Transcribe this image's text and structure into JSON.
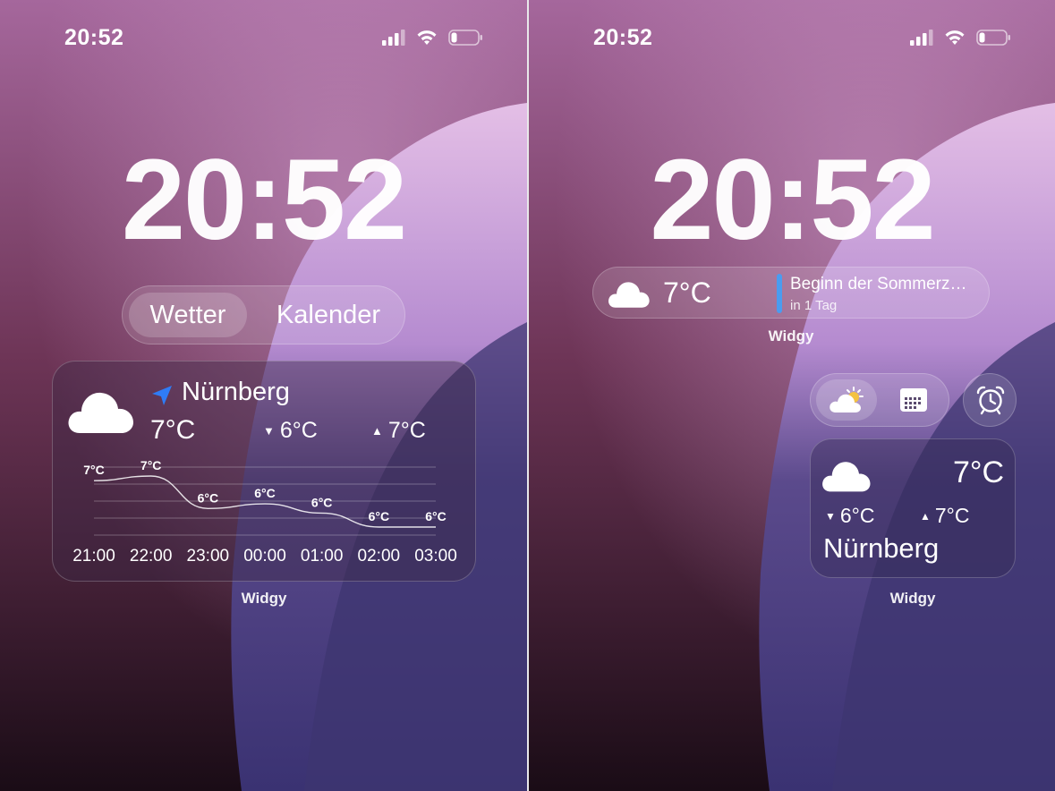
{
  "status_bar": {
    "time": "20:52"
  },
  "lock_clock": "20:52",
  "left": {
    "segment": {
      "items": [
        "Wetter",
        "Kalender"
      ],
      "selected": "Wetter"
    },
    "weather_widget": {
      "location": "Nürnberg",
      "current_temp": "7°C",
      "low": "6°C",
      "high": "7°C",
      "hourly": [
        {
          "time": "21:00",
          "temp_label": "7°C",
          "temp": 7.0
        },
        {
          "time": "22:00",
          "temp_label": "7°C",
          "temp": 7.1
        },
        {
          "time": "23:00",
          "temp_label": "6°C",
          "temp": 6.4
        },
        {
          "time": "00:00",
          "temp_label": "6°C",
          "temp": 6.5
        },
        {
          "time": "01:00",
          "temp_label": "6°C",
          "temp": 6.3
        },
        {
          "time": "02:00",
          "temp_label": "6°C",
          "temp": 6.0
        },
        {
          "time": "03:00",
          "temp_label": "6°C",
          "temp": 6.0
        }
      ]
    },
    "caption": "Widgy"
  },
  "right": {
    "inline_widget": {
      "temp": "7°C",
      "event_title": "Beginn der Sommerz…",
      "event_subtitle": "in 1 Tag"
    },
    "inline_caption": "Widgy",
    "small_widget": {
      "temp": "7°C",
      "low": "6°C",
      "high": "7°C",
      "location": "Nürnberg"
    },
    "small_caption": "Widgy"
  },
  "colors": {
    "accent_blue": "#2f7cf6",
    "event_bar": "#4a9cf0"
  },
  "icons": [
    "cellular-signal-icon",
    "wifi-icon",
    "battery-icon",
    "cloud-icon",
    "location-arrow-icon",
    "cloud-sun-icon",
    "calendar-icon",
    "alarm-clock-icon"
  ]
}
